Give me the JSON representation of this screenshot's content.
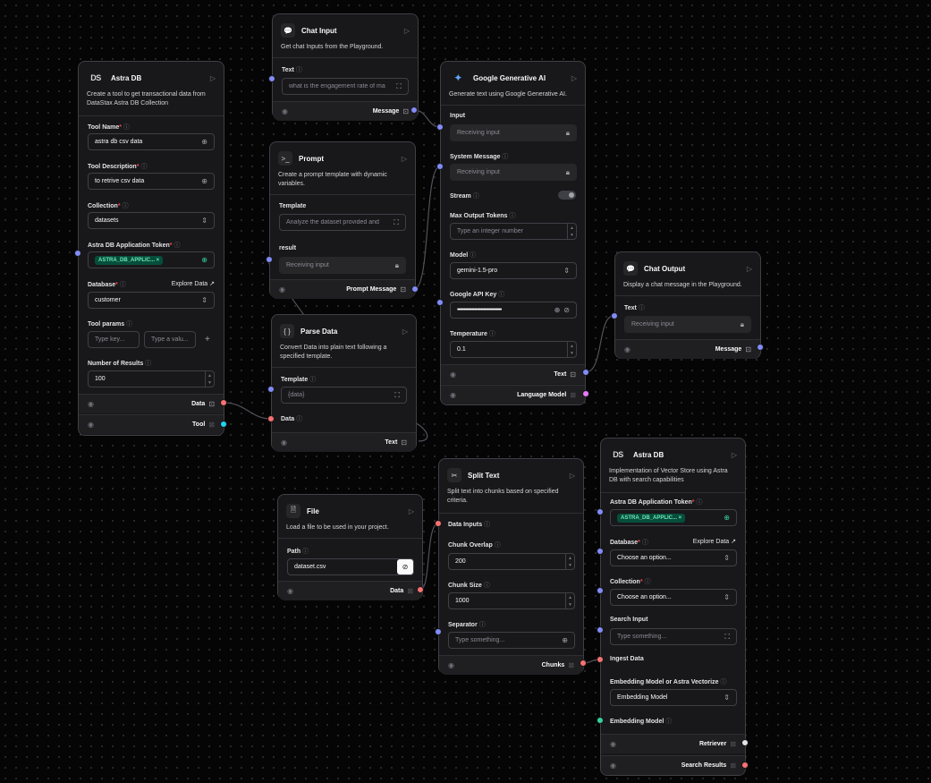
{
  "colors": {
    "background": "#050505",
    "node": "#18181b",
    "border": "#3f3f46",
    "handle_blue": "#818cf8",
    "handle_red": "#f87171",
    "handle_cyan": "#22d3ee",
    "handle_pink": "#e879f9",
    "handle_green": "#34d399",
    "badge_green": "#6ee7b7"
  },
  "astra_tool": {
    "icon": "DS",
    "title": "Astra DB",
    "desc": "Create a tool to get transactional data from DataStax Astra DB Collection",
    "tool_name_label": "Tool Name",
    "tool_name_value": "astra db csv data",
    "tool_desc_label": "Tool Description",
    "tool_desc_value": "to retrive csv data",
    "collection_label": "Collection",
    "collection_value": "datasets",
    "token_label": "Astra DB Application Token",
    "token_value": "ASTRA_DB_APPLIC...",
    "database_label": "Database",
    "database_link": "Explore Data",
    "database_value": "customer",
    "params_label": "Tool params",
    "params_key_ph": "Type key...",
    "params_val_ph": "Type a valu...",
    "results_label": "Number of Results",
    "results_value": "100",
    "out_data": "Data",
    "out_tool": "Tool"
  },
  "chat_input": {
    "title": "Chat Input",
    "desc": "Get chat Inputs from the Playground.",
    "text_label": "Text",
    "text_value": "what is the engagement rate of ma",
    "out_message": "Message"
  },
  "prompt": {
    "title": "Prompt",
    "desc": "Create a prompt template with dynamic variables.",
    "template_label": "Template",
    "template_value": "Analyze the dataset provided and",
    "result_label": "result",
    "result_value": "Receiving input",
    "out_label": "Prompt Message"
  },
  "parse_data": {
    "icon": "{ }",
    "title": "Parse Data",
    "desc": "Convert Data into plain text following a specified template.",
    "template_label": "Template",
    "template_value": "{data}",
    "data_label": "Data",
    "out_label": "Text"
  },
  "gemini": {
    "title": "Google Generative AI",
    "desc": "Generate text using Google Generative AI.",
    "input_label": "Input",
    "input_value": "Receiving input",
    "system_label": "System Message",
    "system_value": "Receiving input",
    "stream_label": "Stream",
    "max_tokens_label": "Max Output Tokens",
    "max_tokens_ph": "Type an integer number",
    "model_label": "Model",
    "model_value": "gemini-1.5-pro",
    "api_key_label": "Google API Key",
    "api_key_value": "••••••••••••••••••••••••••••••••••",
    "temp_label": "Temperature",
    "temp_value": "0.1",
    "out_text": "Text",
    "out_lm": "Language Model"
  },
  "chat_output": {
    "title": "Chat Output",
    "desc": "Display a chat message in the Playground.",
    "text_label": "Text",
    "text_value": "Receiving input",
    "out_message": "Message"
  },
  "file": {
    "title": "File",
    "desc": "Load a file to be used in your project.",
    "path_label": "Path",
    "path_value": "dataset.csv",
    "out_data": "Data"
  },
  "split_text": {
    "title": "Split Text",
    "desc": "Split text into chunks based on specified criteria.",
    "inputs_label": "Data Inputs",
    "overlap_label": "Chunk Overlap",
    "overlap_value": "200",
    "size_label": "Chunk Size",
    "size_value": "1000",
    "separator_label": "Separator",
    "separator_ph": "Type something...",
    "out_label": "Chunks"
  },
  "astra_store": {
    "icon": "DS",
    "title": "Astra DB",
    "desc": "Implementation of Vector Store using Astra DB with search capabilities",
    "token_label": "Astra DB Application Token",
    "token_value": "ASTRA_DB_APPLIC...",
    "database_label": "Database",
    "database_link": "Explore Data",
    "database_ph": "Choose an option...",
    "collection_label": "Collection",
    "collection_ph": "Choose an option...",
    "search_label": "Search Input",
    "search_ph": "Type something...",
    "ingest_label": "Ingest Data",
    "emb_mode_label": "Embedding Model or Astra Vectorize",
    "emb_mode_value": "Embedding Model",
    "emb_label": "Embedding Model",
    "out_retriever": "Retriever",
    "out_results": "Search Results"
  }
}
